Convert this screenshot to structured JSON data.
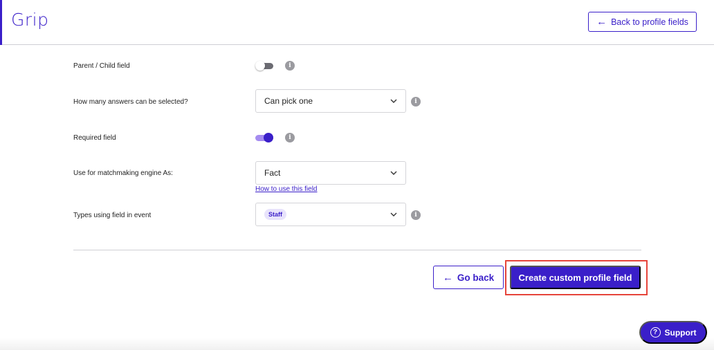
{
  "header": {
    "logo_text": "Grip",
    "back_button_label": "Back to profile fields"
  },
  "fields": {
    "parent_child": {
      "label": "Parent / Child field",
      "enabled": false
    },
    "answers": {
      "label": "How many answers can be selected?",
      "value": "Can pick one"
    },
    "required": {
      "label": "Required field",
      "enabled": true
    },
    "matchmaking": {
      "label": "Use for matchmaking engine As:",
      "value": "Fact",
      "help_link": "How to use this field"
    },
    "types": {
      "label": "Types using field in event",
      "tag": "Staff"
    }
  },
  "actions": {
    "go_back_label": "Go back",
    "create_label": "Create custom profile field"
  },
  "support": {
    "label": "Support"
  },
  "colors": {
    "accent": "#3a1fc9",
    "highlight": "#e6443a"
  },
  "icons": {
    "info": "info-icon",
    "chevron": "chevron-down-icon",
    "arrow": "arrow-left-icon",
    "help": "question-icon"
  }
}
